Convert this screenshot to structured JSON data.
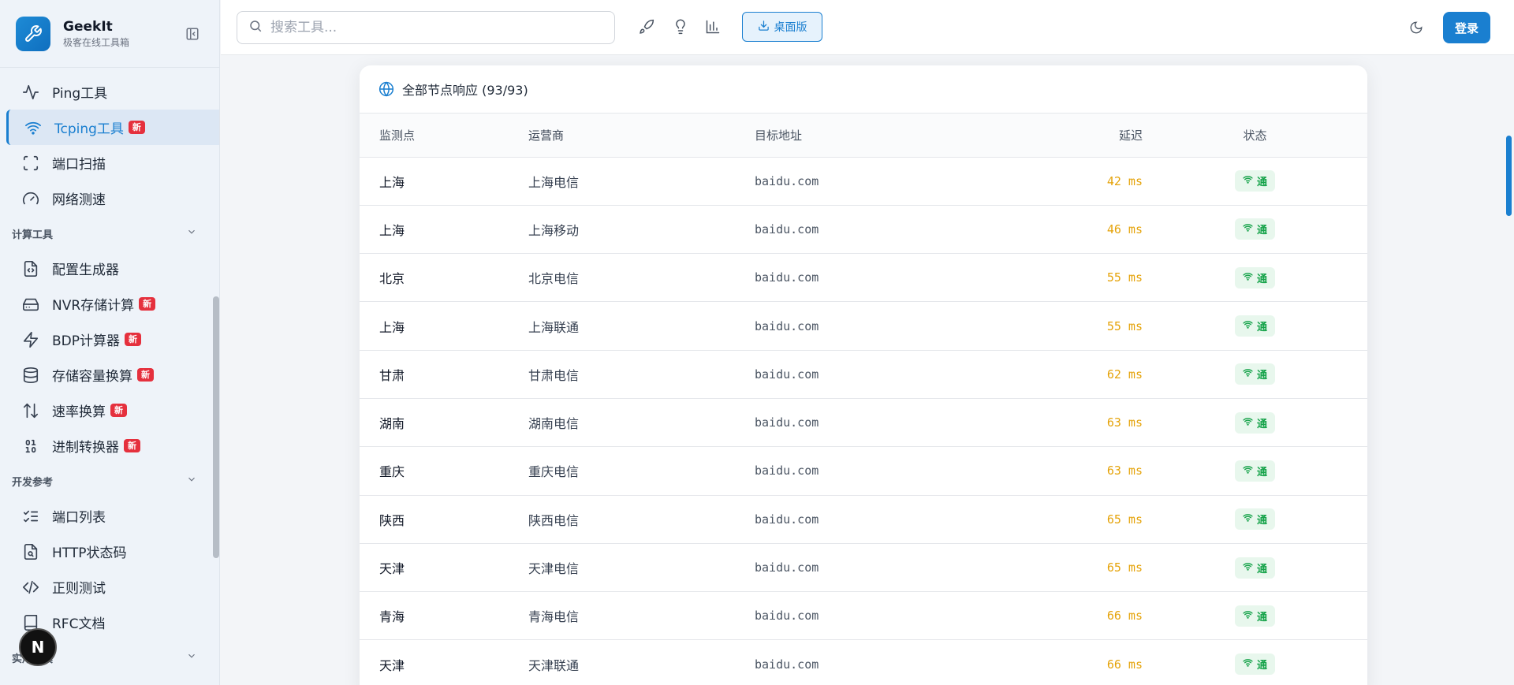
{
  "brand": {
    "name": "GeekIt",
    "subtitle": "极客在线工具箱"
  },
  "sidebar": {
    "items_top": [
      {
        "label": "Ping工具",
        "icon": "activity-icon",
        "active": false,
        "badge": ""
      },
      {
        "label": "Tcping工具",
        "icon": "wifi-icon",
        "active": true,
        "badge": "新"
      },
      {
        "label": "端口扫描",
        "icon": "scan-icon",
        "active": false,
        "badge": ""
      },
      {
        "label": "网络测速",
        "icon": "gauge-icon",
        "active": false,
        "badge": ""
      }
    ],
    "section_calc": "计算工具",
    "items_calc": [
      {
        "label": "配置生成器",
        "icon": "file-code-icon",
        "badge": ""
      },
      {
        "label": "NVR存储计算",
        "icon": "hard-drive-icon",
        "badge": "新"
      },
      {
        "label": "BDP计算器",
        "icon": "zap-icon",
        "badge": "新"
      },
      {
        "label": "存储容量换算",
        "icon": "database-icon",
        "badge": "新"
      },
      {
        "label": "速率换算",
        "icon": "arrow-up-down-icon",
        "badge": "新"
      },
      {
        "label": "进制转换器",
        "icon": "binary-icon",
        "badge": "新"
      }
    ],
    "section_dev": "开发参考",
    "items_dev": [
      {
        "label": "端口列表",
        "icon": "list-checks-icon",
        "badge": ""
      },
      {
        "label": "HTTP状态码",
        "icon": "file-search-icon",
        "badge": ""
      },
      {
        "label": "正则测试",
        "icon": "code-icon",
        "badge": ""
      },
      {
        "label": "RFC文档",
        "icon": "book-icon",
        "badge": ""
      }
    ],
    "section_util": "实用工具",
    "avatar_letter": "N"
  },
  "topbar": {
    "search_placeholder": "搜索工具...",
    "desktop_label": "桌面版",
    "login_label": "登录"
  },
  "card": {
    "title": "全部节点响应 (93/93)",
    "columns": [
      "监测点",
      "运营商",
      "目标地址",
      "延迟",
      "状态"
    ],
    "rows": [
      {
        "location": "上海",
        "isp": "上海电信",
        "target": "baidu.com",
        "latency": "42 ms",
        "status": "通"
      },
      {
        "location": "上海",
        "isp": "上海移动",
        "target": "baidu.com",
        "latency": "46 ms",
        "status": "通"
      },
      {
        "location": "北京",
        "isp": "北京电信",
        "target": "baidu.com",
        "latency": "55 ms",
        "status": "通"
      },
      {
        "location": "上海",
        "isp": "上海联通",
        "target": "baidu.com",
        "latency": "55 ms",
        "status": "通"
      },
      {
        "location": "甘肃",
        "isp": "甘肃电信",
        "target": "baidu.com",
        "latency": "62 ms",
        "status": "通"
      },
      {
        "location": "湖南",
        "isp": "湖南电信",
        "target": "baidu.com",
        "latency": "63 ms",
        "status": "通"
      },
      {
        "location": "重庆",
        "isp": "重庆电信",
        "target": "baidu.com",
        "latency": "63 ms",
        "status": "通"
      },
      {
        "location": "陕西",
        "isp": "陕西电信",
        "target": "baidu.com",
        "latency": "65 ms",
        "status": "通"
      },
      {
        "location": "天津",
        "isp": "天津电信",
        "target": "baidu.com",
        "latency": "65 ms",
        "status": "通"
      },
      {
        "location": "青海",
        "isp": "青海电信",
        "target": "baidu.com",
        "latency": "66 ms",
        "status": "通"
      },
      {
        "location": "天津",
        "isp": "天津联通",
        "target": "baidu.com",
        "latency": "66 ms",
        "status": "通"
      }
    ]
  },
  "colors": {
    "accent": "#1a7fd0",
    "badge": "#e5303d",
    "latency": "#e5a30a",
    "status_ok": "#16a34a"
  }
}
